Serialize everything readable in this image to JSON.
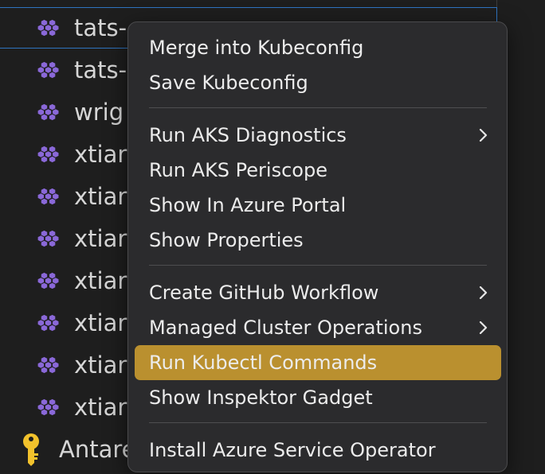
{
  "tree": {
    "items": [
      {
        "label": "tats-",
        "icon": "cluster-icon"
      },
      {
        "label": "tats-",
        "icon": "cluster-icon"
      },
      {
        "label": "wrig",
        "icon": "cluster-icon"
      },
      {
        "label": "xtiar",
        "icon": "cluster-icon"
      },
      {
        "label": "xtiar",
        "icon": "cluster-icon"
      },
      {
        "label": "xtiar",
        "icon": "cluster-icon"
      },
      {
        "label": "xtiar",
        "icon": "cluster-icon"
      },
      {
        "label": "xtiar",
        "icon": "cluster-icon"
      },
      {
        "label": "xtiar",
        "icon": "cluster-icon"
      },
      {
        "label": "xtiar",
        "icon": "cluster-icon"
      }
    ],
    "key_item": {
      "label": "Antare",
      "icon": "key-icon"
    }
  },
  "menu": {
    "group1": [
      "Merge into Kubeconfig",
      "Save Kubeconfig"
    ],
    "group2": [
      "Run AKS Diagnostics",
      "Run AKS Periscope",
      "Show In Azure Portal",
      "Show Properties"
    ],
    "group3": [
      "Create GitHub Workflow",
      "Managed Cluster Operations",
      "Run Kubectl Commands",
      "Show Inspektor Gadget"
    ],
    "group4": [
      "Install Azure Service Operator"
    ],
    "highlighted": "Run Kubectl Commands"
  },
  "colors": {
    "background": "#1e1e1e",
    "menu_background": "#2b2b2d",
    "highlight": "#ba902f",
    "cluster_icon": "#8a68d8",
    "key_icon": "#f2c22c",
    "selection_border": "#2f74c0"
  }
}
